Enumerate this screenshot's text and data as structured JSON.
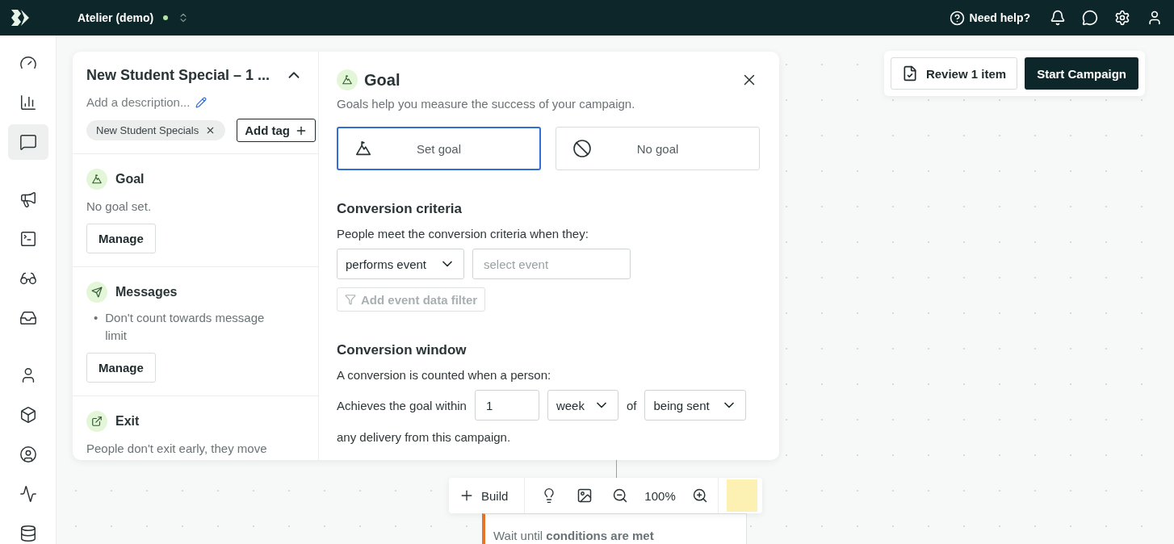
{
  "topbar": {
    "workspace": "Atelier (demo)",
    "help": "Need help?"
  },
  "sidebar": {
    "items": [
      {
        "kind": "dashboard",
        "selected": false
      },
      {
        "kind": "analytics",
        "selected": false
      },
      {
        "kind": "campaigns",
        "selected": true
      },
      {
        "kind": "broadcasts",
        "selected": false
      },
      {
        "kind": "terminal",
        "selected": false
      },
      {
        "kind": "incognito",
        "selected": false
      },
      {
        "kind": "inbox",
        "selected": false
      },
      {
        "kind": "people",
        "selected": false
      },
      {
        "kind": "objects",
        "selected": false
      },
      {
        "kind": "segments",
        "selected": false
      },
      {
        "kind": "activity",
        "selected": false
      },
      {
        "kind": "data",
        "selected": false
      }
    ]
  },
  "campaign": {
    "title": "New Student Special – 1 ...",
    "description_placeholder": "Add a description...",
    "tags": [
      {
        "label": "New Student Specials"
      }
    ],
    "add_tag": "Add tag",
    "sections": [
      {
        "kind": "goal",
        "title": "Goal",
        "text": "No goal set.",
        "button": "Manage"
      },
      {
        "kind": "messages",
        "title": "Messages",
        "bullets": [
          {
            "marker": "•",
            "text": "Don't count towards message limit"
          }
        ],
        "button": "Manage"
      },
      {
        "kind": "exit",
        "title": "Exit",
        "text": "People don't exit early, they move"
      }
    ]
  },
  "goal_panel": {
    "title": "Goal",
    "subtitle": "Goals help you measure the success of your campaign.",
    "options": [
      {
        "kind": "set",
        "label": "Set goal",
        "selected": true
      },
      {
        "kind": "none",
        "label": "No goal",
        "selected": false
      }
    ],
    "criteria": {
      "heading": "Conversion criteria",
      "text": "People meet the conversion criteria when they:",
      "condition": "performs event",
      "event_placeholder": "select event",
      "filter_button": {
        "label": "Add event data filter",
        "disabled": true
      }
    },
    "window": {
      "heading": "Conversion window",
      "text": "A conversion is counted when a person:",
      "prefix": "Achieves the goal within",
      "amount": "1",
      "unit": "week",
      "of": "of",
      "reference": "being sent",
      "suffix": "any delivery from this campaign."
    }
  },
  "actions": {
    "review": "Review 1 item",
    "start": "Start Campaign"
  },
  "toolbar": {
    "build": "Build",
    "zoom": "100%"
  },
  "node": {
    "text": "Wait until **conditions are met**"
  }
}
